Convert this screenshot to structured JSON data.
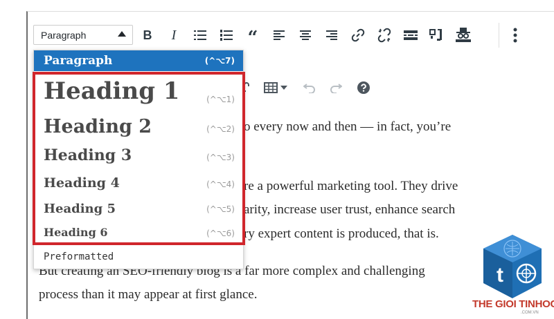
{
  "toolbar": {
    "format_select": {
      "value": "Paragraph"
    },
    "buttons": [
      {
        "name": "bold-icon",
        "glyph": "B"
      },
      {
        "name": "italic-icon",
        "glyph": "I"
      },
      {
        "name": "bulleted-list-icon"
      },
      {
        "name": "numbered-list-icon"
      },
      {
        "name": "blockquote-icon",
        "glyph": "“"
      },
      {
        "name": "align-left-icon"
      },
      {
        "name": "align-center-icon"
      },
      {
        "name": "align-right-icon"
      },
      {
        "name": "insert-link-icon"
      },
      {
        "name": "remove-link-icon"
      },
      {
        "name": "read-more-icon"
      },
      {
        "name": "toolbar-toggle-icon"
      },
      {
        "name": "incognito-icon"
      },
      {
        "name": "more-options-icon"
      }
    ]
  },
  "toolbar2": {
    "buttons": [
      "special-character-icon",
      "table-icon",
      "undo-icon",
      "redo-icon",
      "help-icon"
    ]
  },
  "format_dropdown": {
    "items": [
      {
        "label": "Paragraph",
        "shortcut": "(^⌥7)"
      },
      {
        "label": "Heading 1",
        "shortcut": "(^⌥1)"
      },
      {
        "label": "Heading 2",
        "shortcut": "(^⌥2)"
      },
      {
        "label": "Heading 3",
        "shortcut": "(^⌥3)"
      },
      {
        "label": "Heading 4",
        "shortcut": "(^⌥4)"
      },
      {
        "label": "Heading 5",
        "shortcut": "(^⌥5)"
      },
      {
        "label": "Heading 6",
        "shortcut": "(^⌥6)"
      },
      {
        "label": "Preformatted",
        "shortcut": ""
      }
    ]
  },
  "content": {
    "lines": [
      "o every now and then — in fact, you’re",
      "re a powerful marketing tool. They drive",
      "arity, increase user trust, enhance search",
      "ry expert content is produced, that is.",
      "But creating an SEO-friendly blog is a far more complex and challenging",
      "process than it may appear at first glance."
    ]
  },
  "watermark": {
    "brand": "THE GIOI TINHOC",
    "domain": ".COM.VN"
  },
  "colors": {
    "accent": "#1e73be",
    "highlight": "#d0262c",
    "text": "#2b2b2b",
    "icon": "#2f3b44"
  }
}
